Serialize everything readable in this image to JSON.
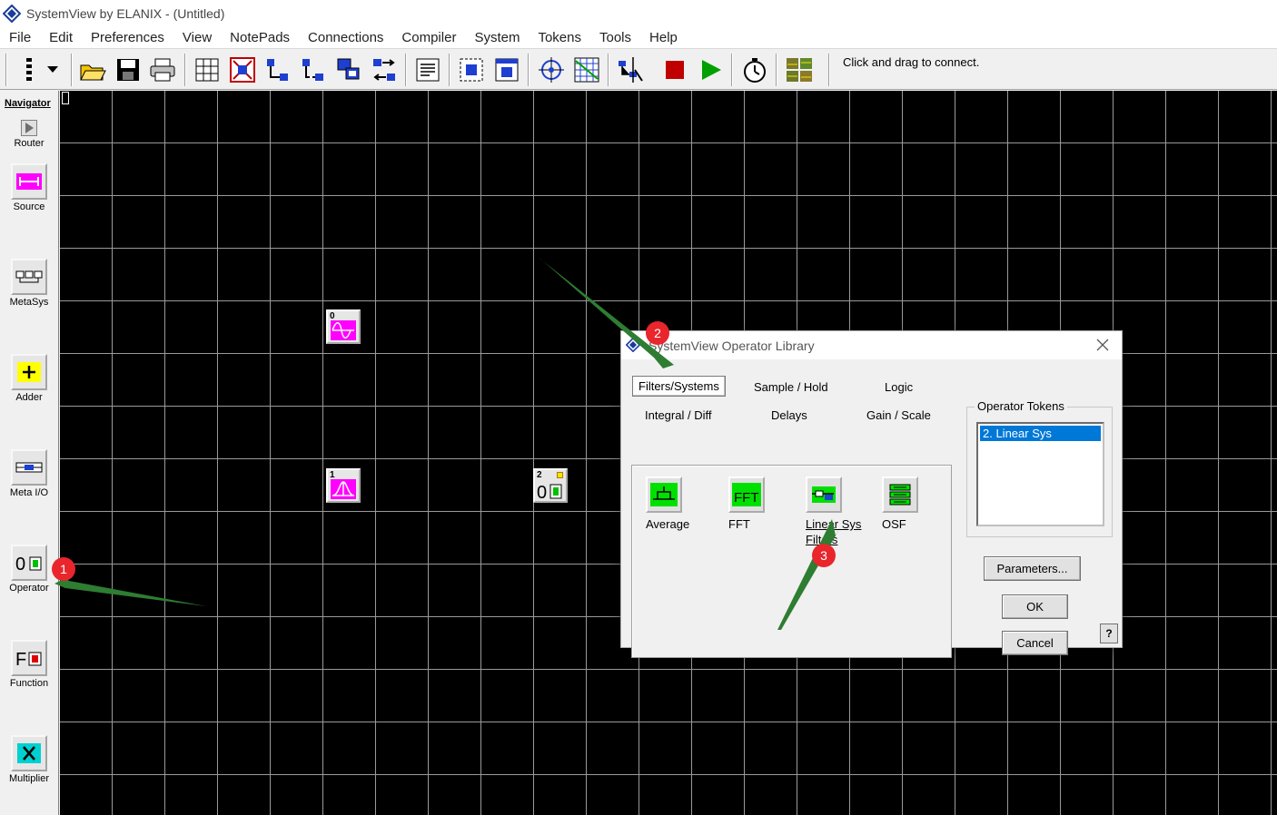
{
  "window": {
    "title": "SystemView by ELANIX - (Untitled)"
  },
  "menu": [
    "File",
    "Edit",
    "Preferences",
    "View",
    "NotePads",
    "Connections",
    "Compiler",
    "System",
    "Tokens",
    "Tools",
    "Help"
  ],
  "toolbar": {
    "status_hint": "Click and drag to connect."
  },
  "navigator": {
    "title": "Navigator",
    "items": [
      {
        "label": "Router"
      },
      {
        "label": "Source"
      },
      {
        "label": "MetaSys"
      },
      {
        "label": "Adder"
      },
      {
        "label": "Meta I/O"
      },
      {
        "label": "Operator"
      },
      {
        "label": "Function"
      },
      {
        "label": "Multiplier"
      }
    ]
  },
  "canvas": {
    "tokens": [
      {
        "number": "0"
      },
      {
        "number": "1"
      },
      {
        "number": "2"
      }
    ]
  },
  "dialog": {
    "title": "SystemView Operator Library",
    "tabs": [
      "Filters/Systems",
      "Sample / Hold",
      "Logic",
      "Integral / Diff",
      "Delays",
      "Gain / Scale"
    ],
    "operators": [
      {
        "label": "Average"
      },
      {
        "label": "FFT",
        "icon_text": "FFT"
      },
      {
        "label": "Linear Sys Filters"
      },
      {
        "label": "OSF"
      }
    ],
    "operator_tokens": {
      "title": "Operator Tokens",
      "items": [
        "2. Linear Sys"
      ]
    },
    "buttons": {
      "parameters": "Parameters...",
      "ok": "OK",
      "cancel": "Cancel",
      "help": "?"
    }
  },
  "annotations": {
    "badges": [
      "1",
      "2",
      "3"
    ],
    "color": "#e8262b",
    "arrow_color": "#2e7d32"
  },
  "colors": {
    "token_magenta": "#ff00ff",
    "selection": "#0078d7",
    "stop_red": "#c00000",
    "run_green": "#00a000"
  }
}
